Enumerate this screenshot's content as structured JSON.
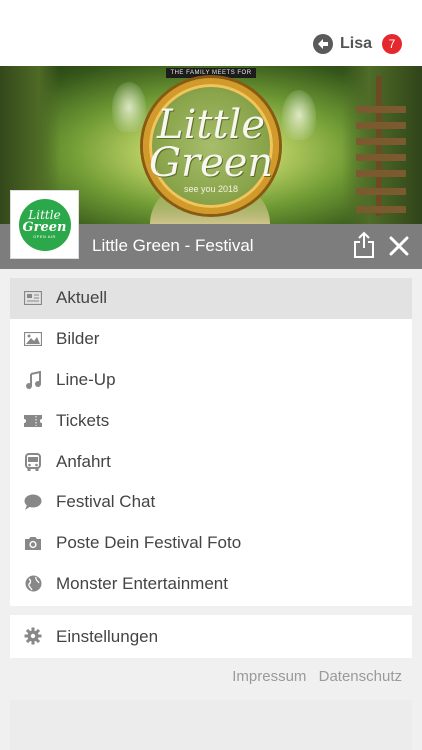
{
  "user": {
    "name": "Lisa",
    "badge_count": "7",
    "logo_icon": "app-logo-icon"
  },
  "hero": {
    "banner_text": "THE FAMILY MEETS FOR DANCING",
    "brand_line1": "Little",
    "brand_line2": "Green",
    "tagline": "see you 2018"
  },
  "event": {
    "logo_line1": "Little",
    "logo_line2": "Green",
    "logo_line3": "OPEN AIR",
    "title": "Little Green - Festival"
  },
  "menu": {
    "items": [
      {
        "label": "Aktuell",
        "icon": "newspaper-icon",
        "active": true
      },
      {
        "label": "Bilder",
        "icon": "image-icon",
        "active": false
      },
      {
        "label": "Line-Up",
        "icon": "music-note-icon",
        "active": false
      },
      {
        "label": "Tickets",
        "icon": "ticket-icon",
        "active": false
      },
      {
        "label": "Anfahrt",
        "icon": "bus-icon",
        "active": false
      },
      {
        "label": "Festival Chat",
        "icon": "chat-bubble-icon",
        "active": false
      },
      {
        "label": "Poste Dein Festival Foto",
        "icon": "camera-icon",
        "active": false
      },
      {
        "label": "Monster Entertainment",
        "icon": "globe-icon",
        "active": false
      }
    ]
  },
  "settings": {
    "label": "Einstellungen",
    "icon": "gear-icon"
  },
  "footer": {
    "impressum": "Impressum",
    "datenschutz": "Datenschutz"
  },
  "colors": {
    "accent_badge": "#e4282e",
    "title_bar": "#7d7d7d",
    "brand_green": "#2aa84a",
    "active_item": "#e2e2e2"
  }
}
